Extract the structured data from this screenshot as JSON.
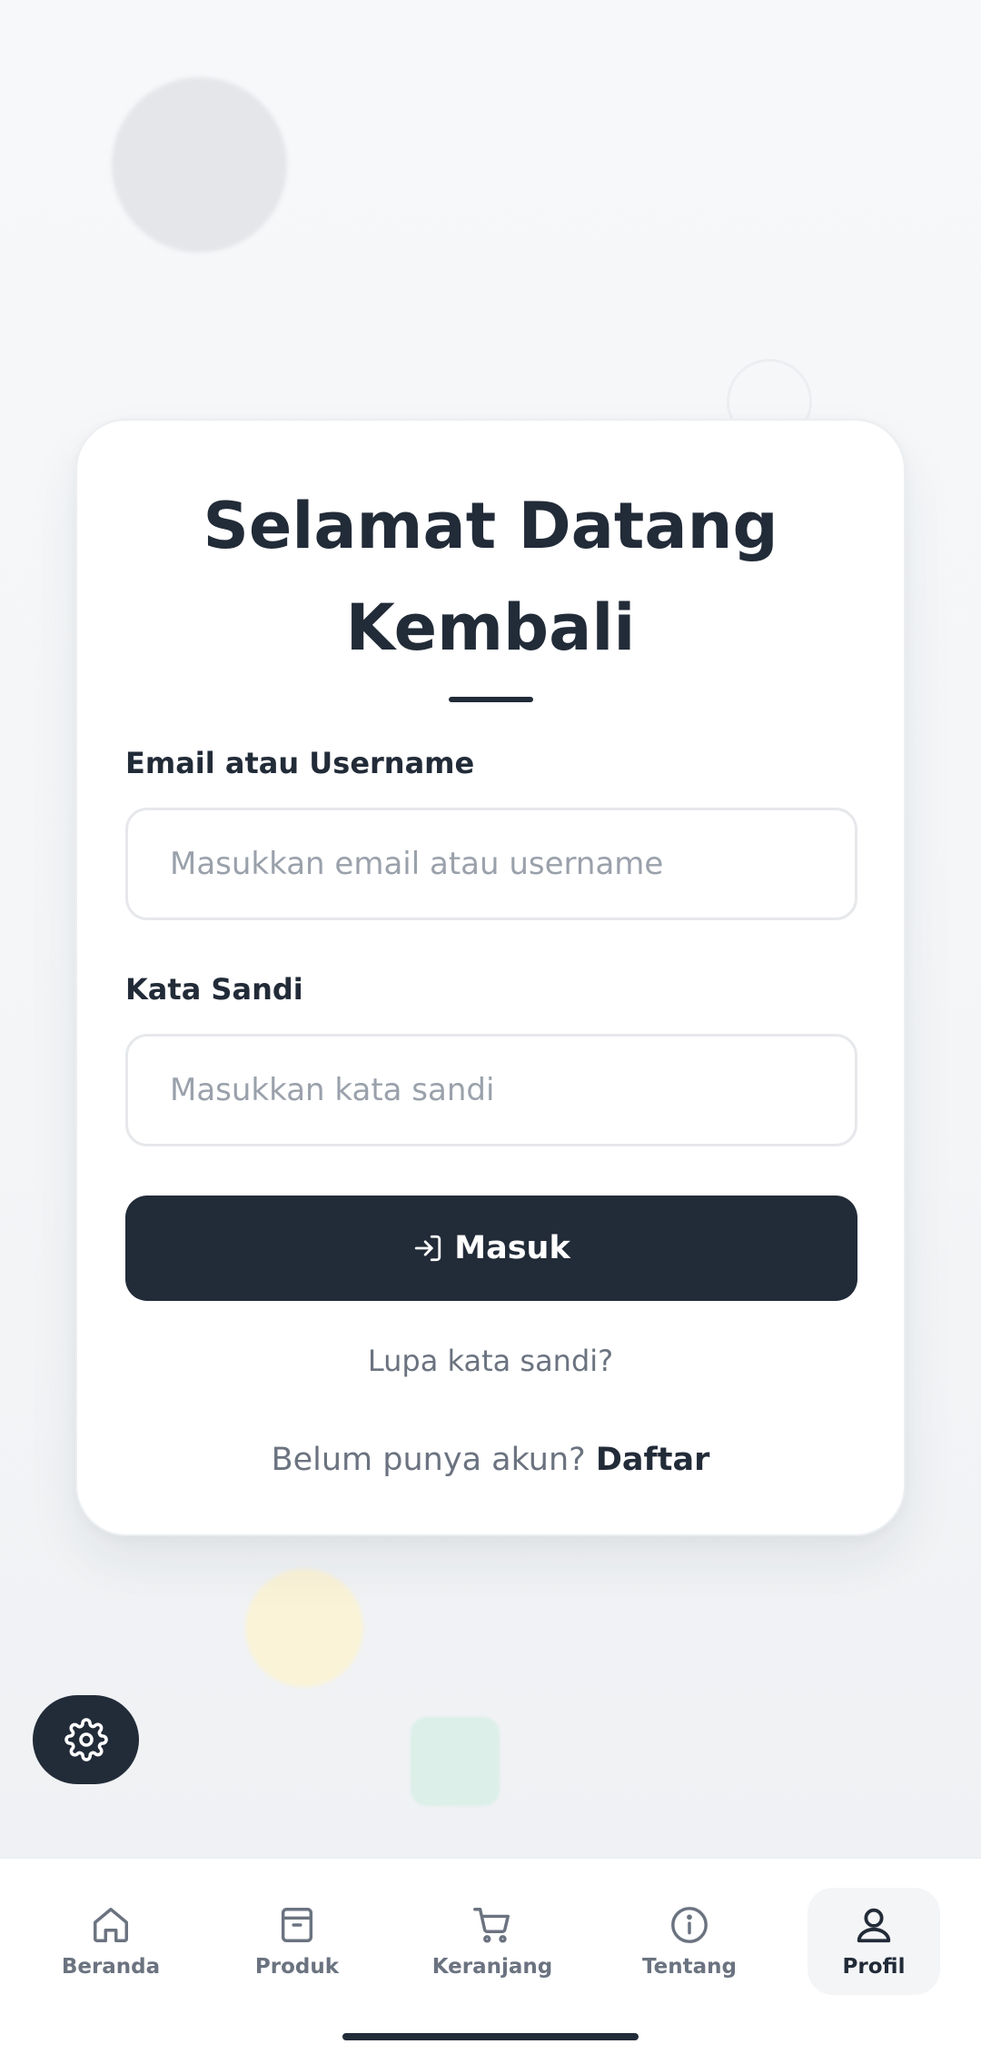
{
  "login": {
    "title": "Selamat Datang Kembali",
    "email_label": "Email atau Username",
    "email_placeholder": "Masukkan email atau username",
    "email_value": "",
    "password_label": "Kata Sandi",
    "password_placeholder": "Masukkan kata sandi",
    "password_value": "",
    "submit_label": "Masuk",
    "submit_icon": "login-arrow-icon",
    "forgot_link": "Lupa kata sandi?",
    "signup_prompt": "Belum punya akun?",
    "signup_link": "Daftar"
  },
  "settings_fab": {
    "icon": "gear-icon"
  },
  "bottom_nav": {
    "items": [
      {
        "label": "Beranda",
        "icon": "home-icon",
        "active": false
      },
      {
        "label": "Produk",
        "icon": "package-icon",
        "active": false
      },
      {
        "label": "Keranjang",
        "icon": "cart-icon",
        "active": false
      },
      {
        "label": "Tentang",
        "icon": "info-icon",
        "active": false
      },
      {
        "label": "Profil",
        "icon": "user-icon",
        "active": true
      }
    ]
  },
  "colors": {
    "primary": "#222b38",
    "muted_text": "#6b7380",
    "placeholder": "#9aa1ab",
    "card_bg": "#ffffff",
    "page_bg": "#f4f5f7"
  }
}
